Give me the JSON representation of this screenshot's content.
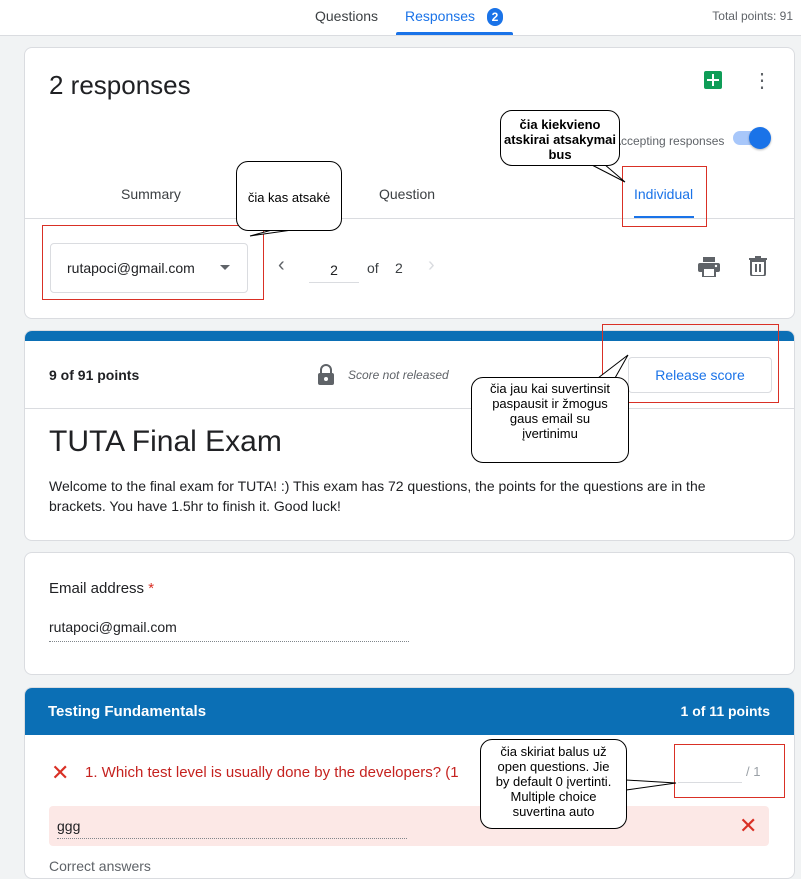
{
  "header": {
    "tabs": [
      "Questions",
      "Responses"
    ],
    "responses_badge": "2",
    "total_points": "Total points: 91"
  },
  "responses_card": {
    "title": "2 responses",
    "accepting_label": "Accepting responses",
    "accepting_on": true,
    "subtabs": [
      "Summary",
      "Question",
      "Individual"
    ],
    "active_subtab": "Individual",
    "respondent": "rutapoci@gmail.com",
    "page_current": "2",
    "page_of": "of",
    "page_total": "2"
  },
  "score_card": {
    "points": "9 of 91 points",
    "score_status": "Score not released",
    "release_button": "Release score",
    "form_title": "TUTA Final Exam",
    "form_description": "Welcome to the final exam for TUTA! :) This exam has 72 questions, the points for the questions are in the brackets. You have 1.5hr to finish it. Good luck!"
  },
  "email_card": {
    "label": "Email address",
    "required_mark": "*",
    "value": "rutapoci@gmail.com"
  },
  "section": {
    "title": "Testing Fundamentals",
    "points": "1 of 11 points",
    "question": "1. Which test level is usually done by the developers? (1",
    "score_value": "",
    "score_max": "/ 1",
    "answer": "ggg",
    "correct_label": "Correct answers"
  },
  "annotations": {
    "individual_note": "čia kiekvieno atskirai atsakymai bus",
    "who_answered_note": "čia kas atsakė",
    "release_note": "čia jau kai suvertinsit paspausit ir žmogus gaus email su įvertinimu",
    "scoring_note": "čia skiriat balus už open questions. Jie by default 0 įvertinti. Multiple choice suvertina auto"
  },
  "colors": {
    "accent": "#1a73e8",
    "section_header": "#0b6fb5",
    "incorrect": "#d93025",
    "annotation_box": "#d93025"
  }
}
